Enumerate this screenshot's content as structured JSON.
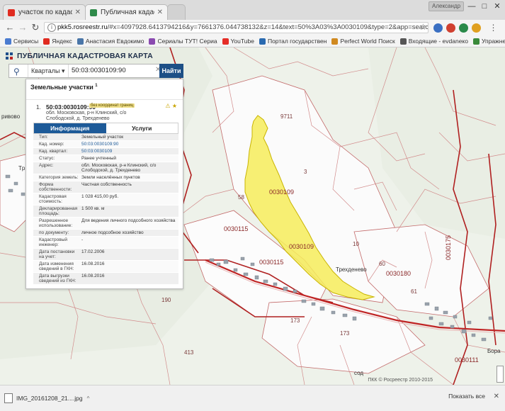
{
  "browser": {
    "tabs": [
      {
        "title": "участок по кадастрово",
        "active": false
      },
      {
        "title": "Публичная кадастровая",
        "active": true
      }
    ],
    "user_label": "Александр",
    "window_controls": [
      "—",
      "□",
      "✕"
    ],
    "nav": {
      "back": "←",
      "forward": "→",
      "reload": "↻"
    },
    "url_host": "pkk5.rosreestr.ru",
    "url_path": "/#x=4097928.6413794216&y=7661376.044738132&z=14&text=50%3A03%3A0030109&type=2&app=search&opened=1",
    "bookmarks": [
      {
        "label": "Сервисы",
        "color": "#4a7bd0"
      },
      {
        "label": "Яндекс",
        "color": "#e02b20"
      },
      {
        "label": "Анастасия Евдокимо",
        "color": "#4a76a8"
      },
      {
        "label": "Сериалы ТУТ! Сериа",
        "color": "#8a4ab0"
      },
      {
        "label": "YouTube",
        "color": "#e52d27"
      },
      {
        "label": "Портал государствен",
        "color": "#2a6ab0"
      },
      {
        "label": "Perfect World Поиск",
        "color": "#d08a20"
      },
      {
        "label": "Входящие - evdaneко",
        "color": "#555555"
      },
      {
        "label": "Упражнения для спи",
        "color": "#3a8a3a"
      }
    ]
  },
  "app": {
    "title": "ПУБЛИЧНАЯ КАДАСТРОВАЯ КАРТА",
    "search": {
      "layer": "Кварталы",
      "query": "50:03:0030109:90",
      "button": "Найти"
    },
    "panel": {
      "heading": "Земельные участки",
      "count": "1",
      "result": {
        "index": "1.",
        "cad_number": "50:03:0030109:90",
        "flag": "без координат границ",
        "address": "обл. Московская, р-н Клинский, с/о Слободской, д. Трехденево"
      },
      "tabs": [
        "Информация",
        "Услуги"
      ],
      "properties": [
        {
          "k": "Тип:",
          "v": "Земельный участок",
          "link": false
        },
        {
          "k": "Кад. номер:",
          "v": "50:03:0030109:90",
          "link": true
        },
        {
          "k": "Кад. квартал:",
          "v": "50:03:0030109",
          "link": true
        },
        {
          "k": "Статус:",
          "v": "Ранее учтенный",
          "link": false
        },
        {
          "k": "Адрес:",
          "v": "обл. Московская, р-н Клинский, с/о Слободской, д. Трехденево",
          "link": false
        },
        {
          "k": "Категория земель:",
          "v": "Земли населённых пунктов",
          "link": false
        },
        {
          "k": "Форма собственности:",
          "v": "Частная собственность",
          "link": false
        },
        {
          "k": "Кадастровая стоимость:",
          "v": "1 028 415,00 руб.",
          "link": false
        },
        {
          "k": "Декларированная площадь:",
          "v": "1 500 кв. м",
          "link": false
        },
        {
          "k": "Разрешенное использование:",
          "v": "Для ведения личного подсобного хозяйства",
          "link": false
        },
        {
          "k": "по документу:",
          "v": "личное подсобное хозяйство",
          "link": false
        },
        {
          "k": "Кадастровый инженер:",
          "v": "-",
          "link": false
        },
        {
          "k": "Дата постановки на учет:",
          "v": "17.02.2006",
          "link": false
        },
        {
          "k": "Дата изменения сведений в ГКН:",
          "v": "16.08.2016",
          "link": false
        },
        {
          "k": "Дата выгрузки сведений из ГКН:",
          "v": "16.08.2016",
          "link": false
        }
      ]
    },
    "map": {
      "highlight_color": "#f6ec5a",
      "labels": [
        "9711",
        "3",
        "0030109",
        "58",
        "0030115",
        "0030109",
        "10",
        "0030115",
        "Трехденево",
        "60",
        "0030180",
        "61",
        "0030175",
        "173",
        "173",
        "0030111",
        "190",
        "413",
        "ривово",
        "Tp",
        "Бора",
        "сод"
      ],
      "copyright": "ПКК © Росреестр 2010-2015"
    }
  },
  "download_bar": {
    "file": "IMG_20161208_21....jpg",
    "show_all": "Показать все",
    "close": "✕"
  }
}
